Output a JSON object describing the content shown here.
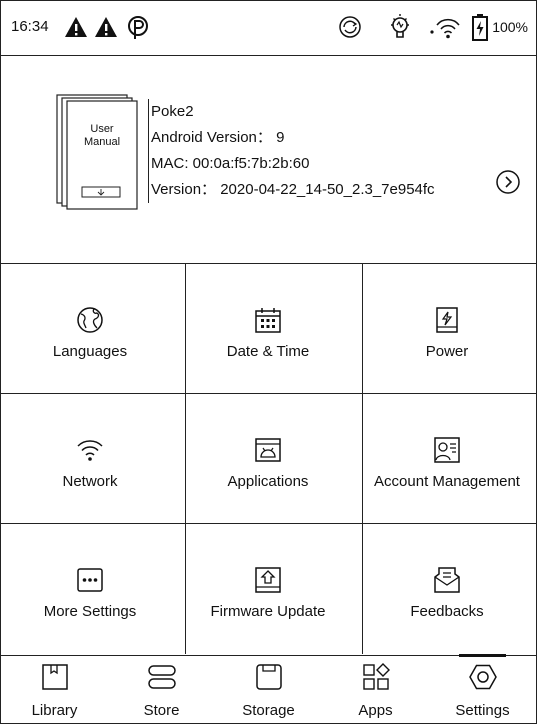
{
  "status_bar": {
    "time": "16:34",
    "battery_percent": "100%",
    "icons": [
      "alert-icon",
      "alert-icon",
      "p-circle-icon",
      "sync-icon",
      "bulb-icon",
      "wifi-icon",
      "battery-charging-icon"
    ]
  },
  "device_info": {
    "manual_title_line1": "User",
    "manual_title_line2": "Manual",
    "model": "Poke2",
    "android_version": "Android Version： 9",
    "mac": "MAC: 00:0a:f5:7b:2b:60",
    "version": "Version： 2020-04-22_14-50_2.3_7e954fc"
  },
  "settings_grid": [
    {
      "label": "Languages",
      "icon": "globe-icon"
    },
    {
      "label": "Date & Time",
      "icon": "calendar-icon"
    },
    {
      "label": "Power",
      "icon": "power-icon"
    },
    {
      "label": "Network",
      "icon": "wifi-icon"
    },
    {
      "label": "Applications",
      "icon": "applications-icon"
    },
    {
      "label": "Account Management",
      "icon": "account-icon"
    },
    {
      "label": "More Settings",
      "icon": "more-icon"
    },
    {
      "label": "Firmware Update",
      "icon": "firmware-icon"
    },
    {
      "label": "Feedbacks",
      "icon": "feedback-icon"
    }
  ],
  "bottom_nav": [
    {
      "label": "Library",
      "icon": "book-icon"
    },
    {
      "label": "Store",
      "icon": "store-icon"
    },
    {
      "label": "Storage",
      "icon": "storage-icon"
    },
    {
      "label": "Apps",
      "icon": "apps-icon"
    },
    {
      "label": "Settings",
      "icon": "settings-icon",
      "active": true
    }
  ],
  "colors": {
    "ink": "#111111",
    "background": "#ffffff"
  }
}
